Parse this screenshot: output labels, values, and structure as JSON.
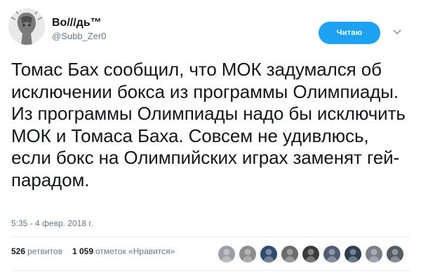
{
  "author": {
    "display_name": "Во///дь™",
    "handle": "@Subb_Zer0",
    "avatar_icon": "profile-avatar-icon"
  },
  "follow_button": {
    "label": "Читаю",
    "color": "#1da1f2"
  },
  "menu_icon": "chevron-down-icon",
  "tweet": {
    "paragraph_1": "Томас Бах сообщил, что МОК задумался об исключении бокса из программы Олимпиады.",
    "paragraph_2": "Из программы Олимпиады надо бы исключить МОК и Томаса Баха. Совсем не удивлюсь, если бокс на Олимпийских играх заменят гей-парадом."
  },
  "timestamp": "5:35 - 4 февр. 2018 г.",
  "stats": {
    "retweets_count": "526",
    "retweets_label": "ретвитов",
    "likes_count": "1 059",
    "likes_label": "отметок «Нравится»"
  },
  "likers": [
    {
      "name": "liker-avatar-1",
      "color": "#9aa0a6"
    },
    {
      "name": "liker-avatar-2",
      "color": "#8c8c8c"
    },
    {
      "name": "liker-avatar-3",
      "color": "#2f4a6d"
    },
    {
      "name": "liker-avatar-4",
      "color": "#6b6b6b"
    },
    {
      "name": "liker-avatar-5",
      "color": "#3a3a3a"
    },
    {
      "name": "liker-avatar-6",
      "color": "#4f5c73"
    },
    {
      "name": "liker-avatar-7",
      "color": "#2c3e50"
    },
    {
      "name": "liker-avatar-8",
      "color": "#7a7f88"
    },
    {
      "name": "liker-avatar-9",
      "color": "#555b63"
    }
  ]
}
